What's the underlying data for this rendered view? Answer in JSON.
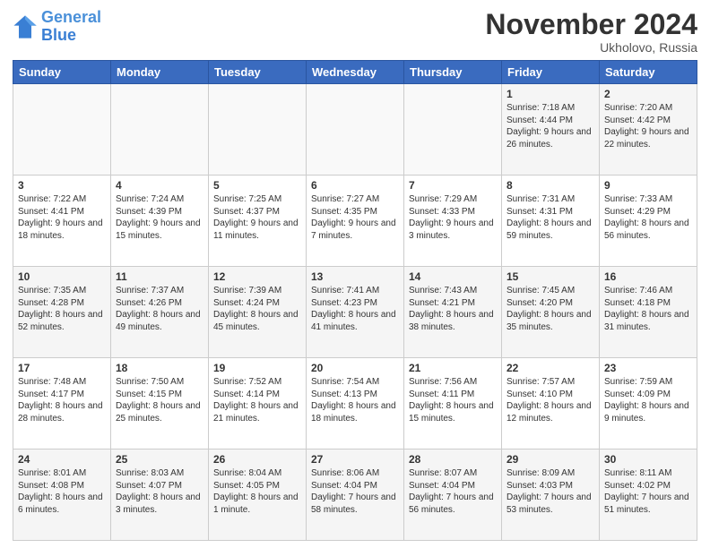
{
  "header": {
    "logo_line1": "General",
    "logo_line2": "Blue",
    "month_title": "November 2024",
    "location": "Ukholovo, Russia"
  },
  "days_of_week": [
    "Sunday",
    "Monday",
    "Tuesday",
    "Wednesday",
    "Thursday",
    "Friday",
    "Saturday"
  ],
  "weeks": [
    [
      {
        "day": "",
        "info": ""
      },
      {
        "day": "",
        "info": ""
      },
      {
        "day": "",
        "info": ""
      },
      {
        "day": "",
        "info": ""
      },
      {
        "day": "",
        "info": ""
      },
      {
        "day": "1",
        "info": "Sunrise: 7:18 AM\nSunset: 4:44 PM\nDaylight: 9 hours and 26 minutes."
      },
      {
        "day": "2",
        "info": "Sunrise: 7:20 AM\nSunset: 4:42 PM\nDaylight: 9 hours and 22 minutes."
      }
    ],
    [
      {
        "day": "3",
        "info": "Sunrise: 7:22 AM\nSunset: 4:41 PM\nDaylight: 9 hours and 18 minutes."
      },
      {
        "day": "4",
        "info": "Sunrise: 7:24 AM\nSunset: 4:39 PM\nDaylight: 9 hours and 15 minutes."
      },
      {
        "day": "5",
        "info": "Sunrise: 7:25 AM\nSunset: 4:37 PM\nDaylight: 9 hours and 11 minutes."
      },
      {
        "day": "6",
        "info": "Sunrise: 7:27 AM\nSunset: 4:35 PM\nDaylight: 9 hours and 7 minutes."
      },
      {
        "day": "7",
        "info": "Sunrise: 7:29 AM\nSunset: 4:33 PM\nDaylight: 9 hours and 3 minutes."
      },
      {
        "day": "8",
        "info": "Sunrise: 7:31 AM\nSunset: 4:31 PM\nDaylight: 8 hours and 59 minutes."
      },
      {
        "day": "9",
        "info": "Sunrise: 7:33 AM\nSunset: 4:29 PM\nDaylight: 8 hours and 56 minutes."
      }
    ],
    [
      {
        "day": "10",
        "info": "Sunrise: 7:35 AM\nSunset: 4:28 PM\nDaylight: 8 hours and 52 minutes."
      },
      {
        "day": "11",
        "info": "Sunrise: 7:37 AM\nSunset: 4:26 PM\nDaylight: 8 hours and 49 minutes."
      },
      {
        "day": "12",
        "info": "Sunrise: 7:39 AM\nSunset: 4:24 PM\nDaylight: 8 hours and 45 minutes."
      },
      {
        "day": "13",
        "info": "Sunrise: 7:41 AM\nSunset: 4:23 PM\nDaylight: 8 hours and 41 minutes."
      },
      {
        "day": "14",
        "info": "Sunrise: 7:43 AM\nSunset: 4:21 PM\nDaylight: 8 hours and 38 minutes."
      },
      {
        "day": "15",
        "info": "Sunrise: 7:45 AM\nSunset: 4:20 PM\nDaylight: 8 hours and 35 minutes."
      },
      {
        "day": "16",
        "info": "Sunrise: 7:46 AM\nSunset: 4:18 PM\nDaylight: 8 hours and 31 minutes."
      }
    ],
    [
      {
        "day": "17",
        "info": "Sunrise: 7:48 AM\nSunset: 4:17 PM\nDaylight: 8 hours and 28 minutes."
      },
      {
        "day": "18",
        "info": "Sunrise: 7:50 AM\nSunset: 4:15 PM\nDaylight: 8 hours and 25 minutes."
      },
      {
        "day": "19",
        "info": "Sunrise: 7:52 AM\nSunset: 4:14 PM\nDaylight: 8 hours and 21 minutes."
      },
      {
        "day": "20",
        "info": "Sunrise: 7:54 AM\nSunset: 4:13 PM\nDaylight: 8 hours and 18 minutes."
      },
      {
        "day": "21",
        "info": "Sunrise: 7:56 AM\nSunset: 4:11 PM\nDaylight: 8 hours and 15 minutes."
      },
      {
        "day": "22",
        "info": "Sunrise: 7:57 AM\nSunset: 4:10 PM\nDaylight: 8 hours and 12 minutes."
      },
      {
        "day": "23",
        "info": "Sunrise: 7:59 AM\nSunset: 4:09 PM\nDaylight: 8 hours and 9 minutes."
      }
    ],
    [
      {
        "day": "24",
        "info": "Sunrise: 8:01 AM\nSunset: 4:08 PM\nDaylight: 8 hours and 6 minutes."
      },
      {
        "day": "25",
        "info": "Sunrise: 8:03 AM\nSunset: 4:07 PM\nDaylight: 8 hours and 3 minutes."
      },
      {
        "day": "26",
        "info": "Sunrise: 8:04 AM\nSunset: 4:05 PM\nDaylight: 8 hours and 1 minute."
      },
      {
        "day": "27",
        "info": "Sunrise: 8:06 AM\nSunset: 4:04 PM\nDaylight: 7 hours and 58 minutes."
      },
      {
        "day": "28",
        "info": "Sunrise: 8:07 AM\nSunset: 4:04 PM\nDaylight: 7 hours and 56 minutes."
      },
      {
        "day": "29",
        "info": "Sunrise: 8:09 AM\nSunset: 4:03 PM\nDaylight: 7 hours and 53 minutes."
      },
      {
        "day": "30",
        "info": "Sunrise: 8:11 AM\nSunset: 4:02 PM\nDaylight: 7 hours and 51 minutes."
      }
    ]
  ]
}
